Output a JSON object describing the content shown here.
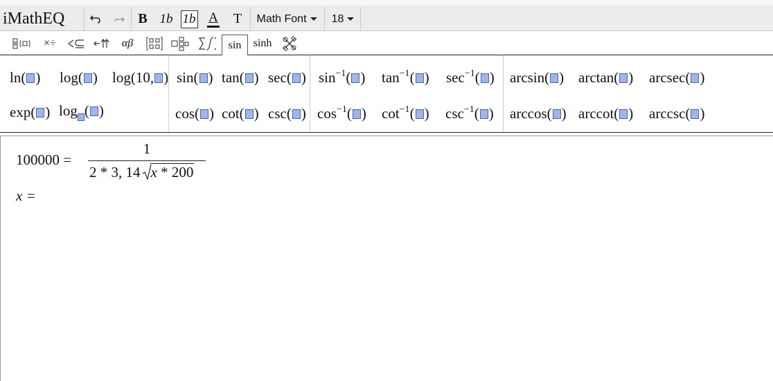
{
  "app": {
    "title": "iMathEQ"
  },
  "toolbar": {
    "bold": "B",
    "italic": "1b",
    "italic_boxed": "1b",
    "font_color": "A",
    "text": "T",
    "font_dropdown": "Math Font",
    "size_dropdown": "18"
  },
  "toolbar2": {
    "arith": "×÷",
    "greek": "αβ",
    "tab_sin": "sin",
    "tab_sinh": "sinh"
  },
  "palette": {
    "ln": "ln(",
    "log": "log(",
    "log10": "log(10,",
    "exp": "exp(",
    "logb": "log",
    "sin": "sin(",
    "tan": "tan(",
    "sec": "sec(",
    "cos": "cos(",
    "cot": "cot(",
    "csc": "csc(",
    "inv_sin": "sin",
    "inv_tan": "tan",
    "inv_sec": "sec",
    "inv_cos": "cos",
    "inv_cot": "cot",
    "inv_csc": "csc",
    "inv_sup": "−1",
    "arcsin": "arcsin(",
    "arctan": "arctan(",
    "arcsec": "arcsec(",
    "arccos": "arccos(",
    "arccot": "arccot(",
    "arccsc": "arccsc(",
    "close": ")"
  },
  "editor": {
    "line1_lhs": "100000 =",
    "numerator": "1",
    "den_prefix": "2 * 3, 14",
    "den_var": "x",
    "den_suffix": " * 200",
    "line2": "x ="
  }
}
